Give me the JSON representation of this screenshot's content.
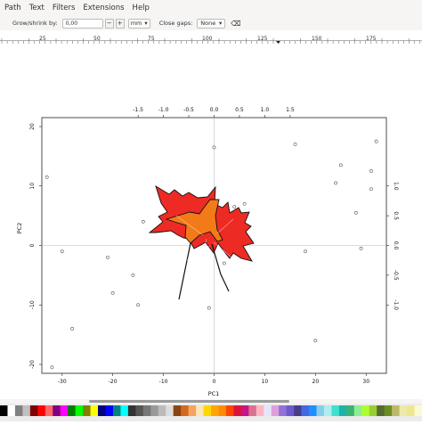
{
  "menu": {
    "items": [
      "Path",
      "Text",
      "Filters",
      "Extensions",
      "Help"
    ]
  },
  "toolbar": {
    "grow_label": "Grow/shrink by:",
    "grow_value": "0,00",
    "grow_unit": "mm",
    "gaps_label": "Close gaps:",
    "gaps_value": "None"
  },
  "ruler": {
    "labels": [
      "25",
      "50",
      "75",
      "100",
      "125",
      "150",
      "175"
    ]
  },
  "chart_data": {
    "type": "scatter",
    "xlabel": "PC1",
    "ylabel": "PC2",
    "xlim": [
      -34,
      34
    ],
    "ylim": [
      -21.5,
      21.5
    ],
    "x_ticks": [
      -30,
      -20,
      -10,
      0,
      10,
      20,
      30
    ],
    "y_ticks": [
      -20,
      -10,
      0,
      10,
      20
    ],
    "top_ticks": [
      -1.5,
      -1.0,
      -0.5,
      0.0,
      0.5,
      1.0,
      1.5
    ],
    "right_ticks": [
      -1.0,
      -0.5,
      0.0,
      0.5,
      1.0
    ],
    "x": [
      -32,
      -33,
      -30,
      -28,
      -21,
      -20,
      -16,
      -15,
      -14,
      0,
      -1,
      2,
      4,
      6,
      16,
      18,
      20,
      24,
      25,
      28,
      29,
      31,
      32,
      31
    ],
    "y": [
      -20.5,
      11.5,
      -1,
      -14,
      -2,
      -8,
      -5,
      -10,
      4,
      16.5,
      -10.5,
      -3,
      6.5,
      7,
      17,
      -1,
      -16,
      10.5,
      13.5,
      5.5,
      -0.5,
      9.5,
      17.5,
      12.5
    ]
  },
  "colors": {
    "leaf_outer": "#ee2a24",
    "leaf_inner": "#f37a18",
    "leaf_stroke": "#111111"
  },
  "palette": [
    "#000000",
    "#ffffff",
    "#808080",
    "#c0c0c0",
    "#800000",
    "#ff0000",
    "#ff6666",
    "#800080",
    "#ff00ff",
    "#008000",
    "#00ff00",
    "#808000",
    "#ffff00",
    "#000080",
    "#0000ff",
    "#008080",
    "#00ffff",
    "#333333",
    "#555555",
    "#777777",
    "#999999",
    "#bbbbbb",
    "#dddddd",
    "#8b4513",
    "#d2691e",
    "#f4a460",
    "#ffe4b5",
    "#ffd700",
    "#ffa500",
    "#ff8c00",
    "#ff4500",
    "#dc143c",
    "#c71585",
    "#db7093",
    "#ffb6c1",
    "#e6e6fa",
    "#dda0dd",
    "#9370db",
    "#6a5acd",
    "#483d8b",
    "#4169e1",
    "#1e90ff",
    "#87ceeb",
    "#afeeee",
    "#40e0d0",
    "#20b2aa",
    "#3cb371",
    "#90ee90",
    "#adff2f",
    "#9acd32",
    "#556b2f",
    "#6b8e23",
    "#bdb76b",
    "#eee8aa",
    "#f0e68c",
    "#fafad2"
  ]
}
